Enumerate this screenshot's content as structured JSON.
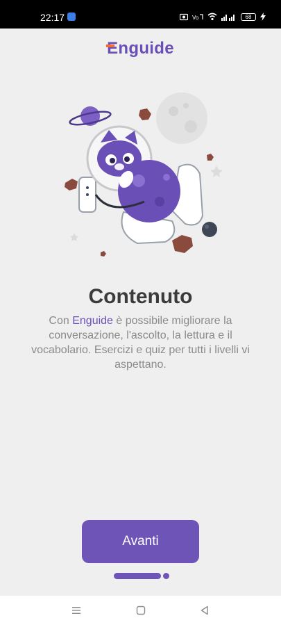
{
  "status_bar": {
    "time": "22:17",
    "battery": "68",
    "icons": [
      "app-notification-icon",
      "screenshot-icon",
      "volte-icon",
      "wifi-icon",
      "signal-icon",
      "battery-icon",
      "charging-icon"
    ]
  },
  "app": {
    "logo_text": "Enguide"
  },
  "onboarding": {
    "title": "Contenuto",
    "description_prefix": "Con ",
    "description_brand": "Enguide",
    "description_rest": " è possibile migliorare la conversazione, l'ascolto, la lettura e il vocabolario. Esercizi e quiz per tutti i livelli vi aspettano.",
    "next_button_label": "Avanti",
    "page_count": 2,
    "current_page": 1
  },
  "navigation_bar": {
    "icons": [
      "menu-icon",
      "home-icon",
      "back-icon"
    ]
  },
  "colors": {
    "accent": "#6f54b8",
    "logo_orange": "#f06a3a",
    "background": "#efefef",
    "title": "#3b3b3b",
    "description": "#8a8a8a"
  }
}
